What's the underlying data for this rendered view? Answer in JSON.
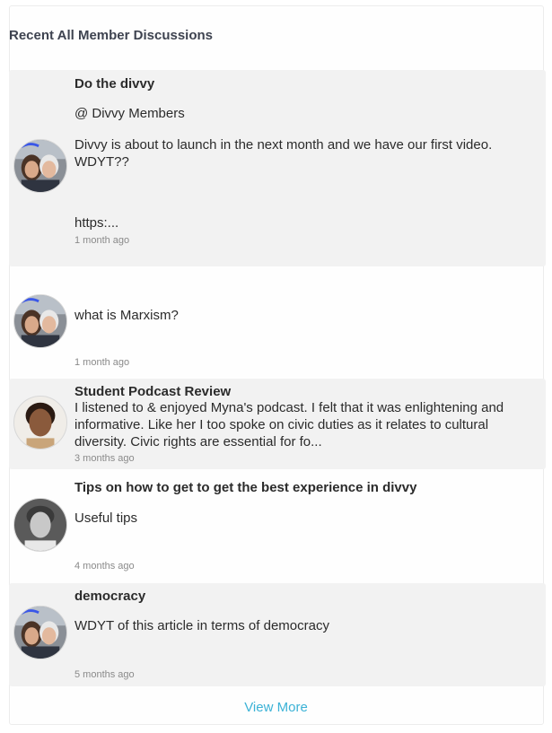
{
  "panel": {
    "title": "Recent All Member Discussions",
    "view_more": "View More"
  },
  "discussions": [
    {
      "title": "Do the divvy",
      "mention": "@ Divvy Members",
      "body": "Divvy is about to launch in the next month and we have our first video. WDYT??",
      "link": "https:...",
      "time": "1 month ago",
      "avatar": "couple-avatar"
    },
    {
      "title": "",
      "body": "what is Marxism?",
      "time": "1 month ago",
      "avatar": "couple-avatar"
    },
    {
      "title": "Student Podcast Review",
      "body": "I listened to & enjoyed Myna's podcast. I felt that it was enlightening and informative. Like her I too spoke on civic duties as it relates to cultural diversity. Civic rights are essential for fo...",
      "time": "3 months ago",
      "avatar": "student-avatar"
    },
    {
      "title": "Tips on how to get to get the best experience in divvy",
      "body": "Useful tips",
      "time": "4 months ago",
      "avatar": "boy-avatar"
    },
    {
      "title": "democracy",
      "body": "WDYT of this article in terms of democracy",
      "time": "5 months ago",
      "avatar": "couple-avatar"
    }
  ]
}
